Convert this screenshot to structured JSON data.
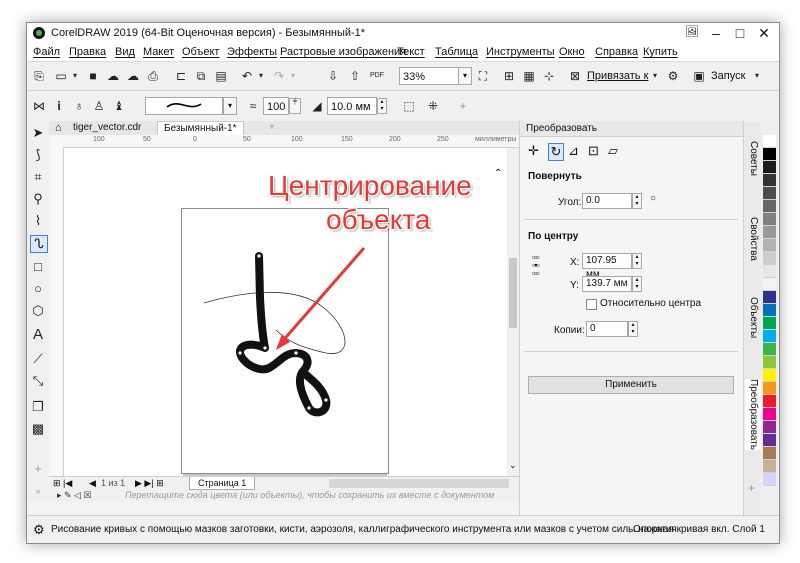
{
  "window": {
    "title": "CorelDRAW 2019 (64-Bit Оценочная версия) - Безымянный-1*",
    "minimize": "‒",
    "maximize": "□",
    "close": "✕"
  },
  "menu": [
    "Файл",
    "Правка",
    "Вид",
    "Макет",
    "Объект",
    "Эффекты",
    "Растровые изображения",
    "Текст",
    "Таблица",
    "Инструменты",
    "Окно",
    "Справка",
    "Купить"
  ],
  "toolbar": {
    "zoom": "33%",
    "snap_label": "Привязать к",
    "launch_label": "Запуск",
    "outline_width": "10.0 мм",
    "smooth_value": "100"
  },
  "tabs": {
    "tab1": "tiger_vector.cdr",
    "tab2": "Безымянный-1*",
    "add": "+"
  },
  "ruler": {
    "ticks": [
      "100",
      "50",
      "0",
      "50",
      "100",
      "150",
      "200",
      "250"
    ],
    "unit": "миллиметры"
  },
  "pagebar": {
    "counter": "1 из 1",
    "page_tab": "Страница 1"
  },
  "drop_hint": "Перетащите сюда цвета (или объекты), чтобы сохранить их вместе с документом",
  "status": {
    "message": "Рисование кривых с помощью мазков заготовки, кисти, аэрозоля, каллиграфического инструмента или мазков с учетом силы нажатия",
    "right": "Опорная кривая вкл. Слой 1"
  },
  "docker": {
    "title": "Преобразовать",
    "rotate_section": "Повернуть",
    "angle_label": "Угол:",
    "angle_value": "0.0",
    "center_section": "По центру",
    "x_label": "X:",
    "x_value": "107.95 мм",
    "y_label": "Y:",
    "y_value": "139.7 мм",
    "relative_label": "Относительно центра",
    "copies_label": "Копии:",
    "copies_value": "0",
    "apply_label": "Применить"
  },
  "side_tabs": [
    "Советы",
    "Свойства",
    "Объекты",
    "Преобразовать"
  ],
  "annotation": {
    "line1": "Центрирование",
    "line2": "объекта",
    "color": "#e53935"
  },
  "palette_colors": [
    "#ffffff",
    "#000000",
    "#1a1a1a",
    "#333333",
    "#4d4d4d",
    "#666666",
    "#808080",
    "#999999",
    "#b3b3b3",
    "#cccccc",
    "#e6e6e6",
    "#f2f2f2",
    "#2e3192",
    "#0072bc",
    "#00a651",
    "#00aeef",
    "#39b54a",
    "#8dc63f",
    "#fff200",
    "#f7941d",
    "#ed1c24",
    "#ec008c",
    "#92278f",
    "#662d91",
    "#a67c52",
    "#c7b299",
    "#d4d4ff"
  ]
}
